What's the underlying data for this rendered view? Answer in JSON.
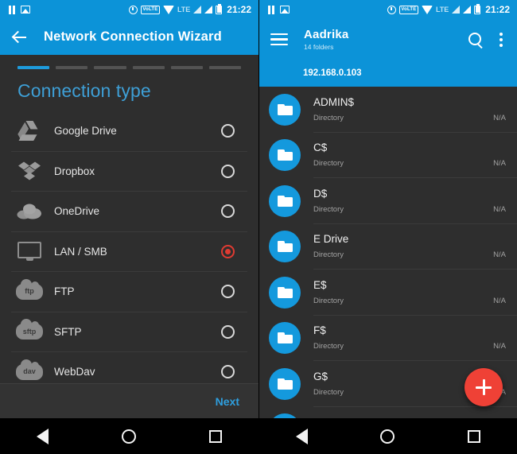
{
  "statusbar": {
    "left_icons": [
      "pause-icon",
      "photo-icon"
    ],
    "right_icons": [
      "alarm-icon",
      "volte-badge",
      "wifi-icon",
      "lte-label",
      "signal-icon-1",
      "signal-icon-2",
      "battery-icon"
    ],
    "volte_label": "VoLTE",
    "lte_label": "LTE",
    "time": "21:22",
    "background": "#0c93d8"
  },
  "left_screen": {
    "appbar": {
      "back_icon": "back-arrow-icon",
      "title": "Network Connection Wizard"
    },
    "wizard": {
      "steps_total": 6,
      "active_step": 1,
      "section_title": "Connection type",
      "options": [
        {
          "label": "Google Drive",
          "icon": "google-drive-icon",
          "selected": false
        },
        {
          "label": "Dropbox",
          "icon": "dropbox-icon",
          "selected": false
        },
        {
          "label": "OneDrive",
          "icon": "onedrive-icon",
          "selected": false
        },
        {
          "label": "LAN / SMB",
          "icon": "monitor-icon",
          "selected": true
        },
        {
          "label": "FTP",
          "icon": "ftp-cloud-icon",
          "badge": "ftp",
          "selected": false
        },
        {
          "label": "SFTP",
          "icon": "sftp-cloud-icon",
          "badge": "sftp",
          "selected": false
        },
        {
          "label": "WebDav",
          "icon": "webdav-cloud-icon",
          "badge": "dav",
          "selected": false
        }
      ],
      "next_label": "Next",
      "accent_color": "#2e9fdf",
      "selected_color": "#e03b32"
    }
  },
  "right_screen": {
    "appbar": {
      "menu_icon": "hamburger-icon",
      "title": "Aadrika",
      "subtitle": "14 folders",
      "search_icon": "search-icon",
      "overflow_icon": "overflow-menu-icon"
    },
    "path": "192.168.0.103",
    "files": [
      {
        "name": "ADMIN$",
        "type": "Directory",
        "size": "N/A"
      },
      {
        "name": "C$",
        "type": "Directory",
        "size": "N/A"
      },
      {
        "name": "D$",
        "type": "Directory",
        "size": "N/A"
      },
      {
        "name": "E Drive",
        "type": "Directory",
        "size": "N/A"
      },
      {
        "name": "E$",
        "type": "Directory",
        "size": "N/A"
      },
      {
        "name": "F$",
        "type": "Directory",
        "size": "N/A"
      },
      {
        "name": "G$",
        "type": "Directory",
        "size": "N/A"
      }
    ],
    "fab": {
      "icon": "plus-icon",
      "color": "#ef4136"
    }
  },
  "navbar": {
    "back": "nav-back-icon",
    "home": "nav-home-icon",
    "recents": "nav-recents-icon"
  }
}
